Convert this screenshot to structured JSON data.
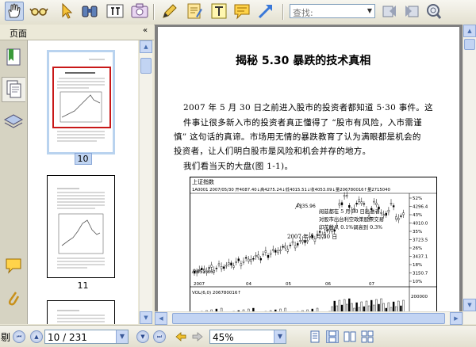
{
  "toolbar": {
    "search_placeholder": "查找:",
    "tools": [
      "hand-tool",
      "reading-glasses-tool",
      "select-arrow-tool",
      "binoculars-tool",
      "text-select-tool",
      "snapshot-camera-tool",
      "pencil-markup-tool",
      "notes-tool",
      "text-box-tool",
      "comment-tool",
      "arrow-tool"
    ],
    "nav": [
      "previous-result",
      "next-result",
      "search-magnifier"
    ]
  },
  "panel": {
    "title": "页面",
    "collapse_label": "«"
  },
  "thumbnails": [
    {
      "page": "10",
      "selected": true
    },
    {
      "page": "11",
      "selected": false
    }
  ],
  "document": {
    "title": "揭秘 5.30 暴跌的技术真相",
    "paragraph_lines": [
      "2007 年 5 月 30 日之前进入股市的投资者都知道 5·30 事件。这",
      "件事让很多新入市的投资者真正懂得了 “股市有风险，入市需谨",
      "慎” 这句话的真谛。市场用无情的暴跌教育了认为满眼都是机会的",
      "投资者，让人们明白股市是风险和机会并存的地方。"
    ],
    "caption": "我们看当天的大盘(图 1-1)。",
    "chart": {
      "name": "上证指数",
      "header": "1A0001 2007/05/30 开4087.40↓高4275.24↓低4015.51↓收4053.09↓量206780016↑量2715040",
      "peak_label": "4335.96",
      "low_label": "2852.86",
      "annotation_lines": [
        "阅兹都在 5 月 30 日出送者",
        "对股市出台利空政策股票交易",
        "印花税从 0.1%调高到 0.3%"
      ],
      "date_label": "2007 年 5 月 30 日",
      "y_ticks": [
        "52%",
        "4296.4",
        "43%",
        "4010.0",
        "35%",
        "3723.5",
        "26%",
        "3437.1",
        "18%",
        "3150.7",
        "10%"
      ],
      "x_labels": [
        "2007",
        "04",
        "05",
        "06",
        "07"
      ],
      "vol_header": "VOL(6,0) 206780016↑",
      "vol_tick": "200000"
    }
  },
  "statusbar": {
    "left_label": "剔",
    "page_value": "10 / 231",
    "zoom_value": "45%"
  },
  "colors": {
    "toolbar_bg": "#ece9d8",
    "doc_bg": "#808080",
    "selection_border": "#b9d3ef",
    "scroll_button": "#c9d8f5"
  }
}
